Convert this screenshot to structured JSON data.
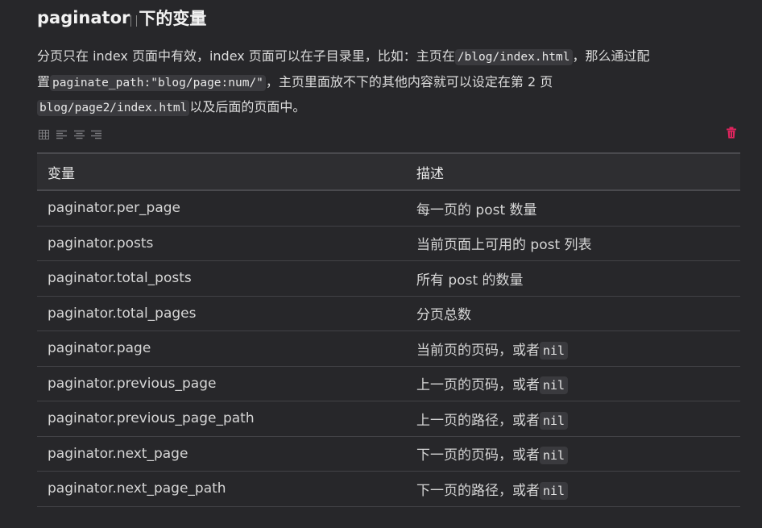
{
  "heading": {
    "code": "paginator",
    "text": "下的变量"
  },
  "paragraph": {
    "l1_text1": "分页只在 index 页面中有效，index 页面可以在子目录里，比如：主页在",
    "l1_code": "/blog/index.html",
    "l1_text2": "，那么通过配",
    "l2_text1": "置",
    "l2_code": "paginate_path:\"blog/page:num/\"",
    "l2_text2": "，主页里面放不下的其他内容就可以设定在第 2 页",
    "l3_code": "blog/page2/index.html",
    "l3_text": "以及后面的页面中。"
  },
  "toolbar": {
    "icons": [
      "table-icon",
      "align-left-icon",
      "align-center-icon",
      "align-right-icon"
    ],
    "delete_icon": "trash-icon",
    "delete_color": "#e0245e"
  },
  "table": {
    "headers": [
      "变量",
      "描述"
    ],
    "rows": [
      {
        "var": "paginator.per_page",
        "desc": "每一页的 post 数量",
        "code": ""
      },
      {
        "var": "paginator.posts",
        "desc": "当前页面上可用的 post 列表",
        "code": ""
      },
      {
        "var": "paginator.total_posts",
        "desc": "所有 post 的数量",
        "code": ""
      },
      {
        "var": "paginator.total_pages",
        "desc": "分页总数",
        "code": ""
      },
      {
        "var": "paginator.page",
        "desc": "当前页的页码，或者",
        "code": "nil"
      },
      {
        "var": "paginator.previous_page",
        "desc": "上一页的页码，或者",
        "code": "nil"
      },
      {
        "var": "paginator.previous_page_path",
        "desc": "上一页的路径，或者",
        "code": "nil"
      },
      {
        "var": "paginator.next_page",
        "desc": "下一页的页码，或者",
        "code": "nil"
      },
      {
        "var": "paginator.next_page_path",
        "desc": "下一页的路径，或者",
        "code": "nil"
      }
    ]
  }
}
